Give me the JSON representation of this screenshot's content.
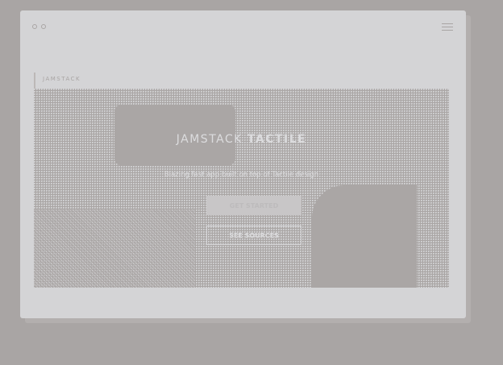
{
  "header": {
    "brand": "JAMSTACK"
  },
  "hero": {
    "title_light": "JAMSTACK ",
    "title_bold": "TACTILE",
    "subtitle": "Blazing fast app built on top of Tactile design",
    "primary_button": "GET STARTED",
    "secondary_button": "SEE SOURCES"
  },
  "colors": {
    "background": "#a9a5a4",
    "card": "#d4d4d6"
  }
}
